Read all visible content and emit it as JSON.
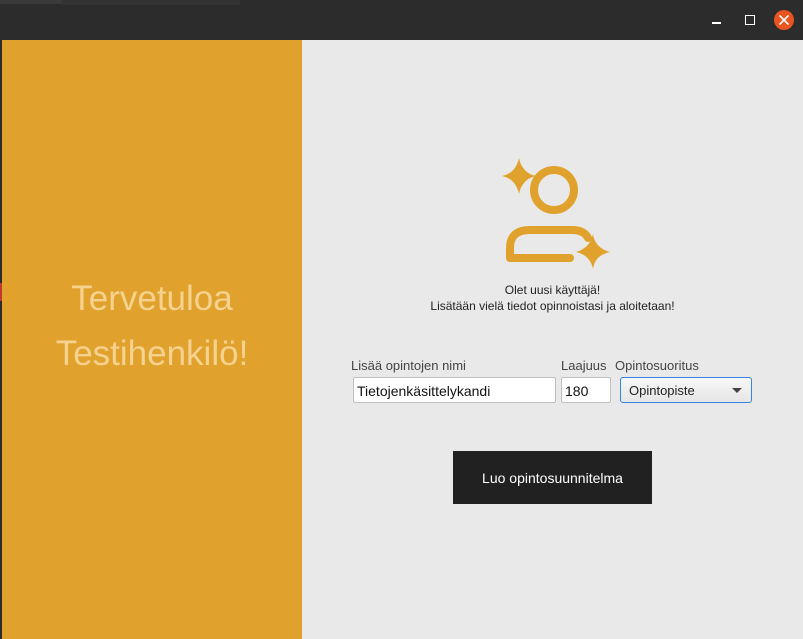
{
  "window": {
    "controls": [
      "minimize-icon",
      "maximize-icon",
      "close-icon"
    ],
    "close_color": "#e95420"
  },
  "welcome": {
    "line1": "Tervetuloa",
    "line2": "Testihenkilö!",
    "panel_color": "#e1a22d"
  },
  "intro": {
    "icon": "user-sparkle-icon",
    "line1": "Olet uusi käyttäjä!",
    "line2": "Lisätään vielä tiedot opinnoistasi ja aloitetaan!"
  },
  "form": {
    "name_label": "Lisää opintojen nimi",
    "name_value": "Tietojenkäsittelykandi",
    "scope_label": "Laajuus",
    "scope_value": "180",
    "unit_label": "Opintosuoritus",
    "unit_selected": "Opintopiste"
  },
  "actions": {
    "create_label": "Luo opintosuunnitelma"
  }
}
